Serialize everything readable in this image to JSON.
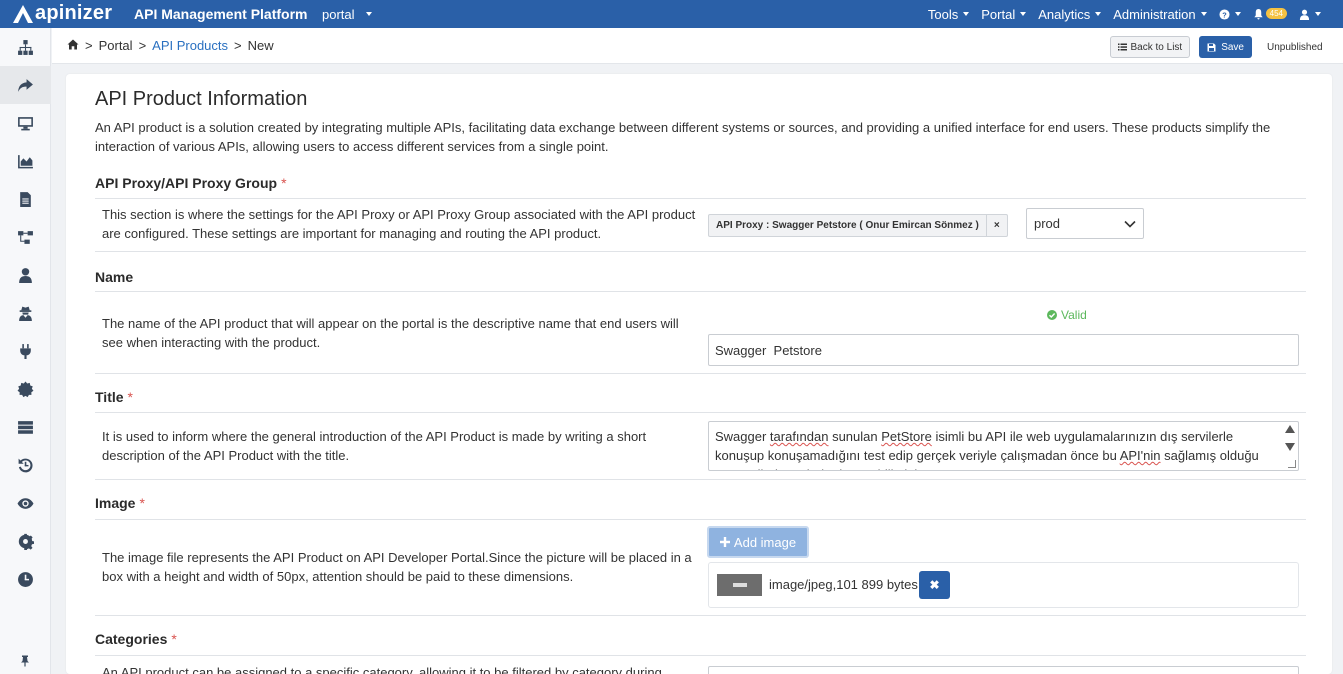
{
  "topbar": {
    "logo_text": "apinizer",
    "app_title": "API Management Platform",
    "environment": "portal",
    "menus": [
      "Tools",
      "Portal",
      "Analytics",
      "Administration"
    ],
    "help_icon": "question-circle-icon",
    "notification_count": "454",
    "user_icon": "user-icon"
  },
  "breadcrumb": {
    "home_icon": "home-icon",
    "sep": ">",
    "items": [
      "Portal",
      "API Products",
      "New"
    ]
  },
  "actions": {
    "back_label": "Back to List",
    "save_label": "Save",
    "status": "Unpublished"
  },
  "page": {
    "heading": "API Product Information",
    "intro": "An API product is a solution created by integrating multiple APIs, facilitating data exchange between different systems or sources, and providing a unified interface for end users. These products simplify the interaction of various APIs, allowing users to access different services from a single point."
  },
  "sections": {
    "proxy": {
      "title": "API Proxy/API Proxy Group",
      "required": "*",
      "description": "This section is where the settings for the API Proxy or API Proxy Group associated with the API product are configured. These settings are important for managing and routing the API product.",
      "tag_label": "API Proxy : Swagger Petstore ( Onur Emircan Sönmez )",
      "tag_remove": "×",
      "env_value": "prod"
    },
    "name": {
      "title": "Name",
      "description": "The name of the API product that will appear on the portal is the descriptive name that end users will see when interacting with the product.",
      "valid_label": "Valid",
      "value": "Swagger  Petstore"
    },
    "title": {
      "title": "Title",
      "required": "*",
      "description": "It is used to inform where the general introduction of the API Product is made by writing a short description of the API Product with the title.",
      "text_parts": [
        "Swagger ",
        "tarafından",
        " sunulan ",
        "PetStore",
        " isimli bu API ile web uygulamalarınızın dış servilerle konuşup konuşamadığını test edip gerçek veriyle çalışmadan önce bu ",
        "API'nin",
        " sağlamış olduğu test verileri üzerinde deneyebilirsiniz."
      ]
    },
    "image": {
      "title": "Image",
      "required": "*",
      "description": "The image file represents the API Product on API Developer Portal.Since the picture will be placed in a box with a height and width of 50px, attention should be paid to these dimensions.",
      "add_label": "Add image",
      "file_info": "image/jpeg,101 899 bytes",
      "remove": "✖"
    },
    "categories": {
      "title": "Categories",
      "required": "*",
      "description": "An API product can be assigned to a specific category, allowing it to be filtered by category during"
    }
  },
  "sidebar": {
    "icons": [
      "sitemap-icon",
      "share-arrow-icon",
      "desktop-icon",
      "area-chart-icon",
      "document-icon",
      "hierarchy-icon",
      "user-icon",
      "user-secret-icon",
      "plug-icon",
      "certificate-icon",
      "server-icon",
      "history-icon",
      "eye-icon",
      "gear-icon",
      "clock-icon",
      "pin-icon"
    ]
  },
  "colors": {
    "brand": "#2a60a8",
    "link": "#2a70c0",
    "required": "#d9534f",
    "valid": "#5cb85c"
  }
}
